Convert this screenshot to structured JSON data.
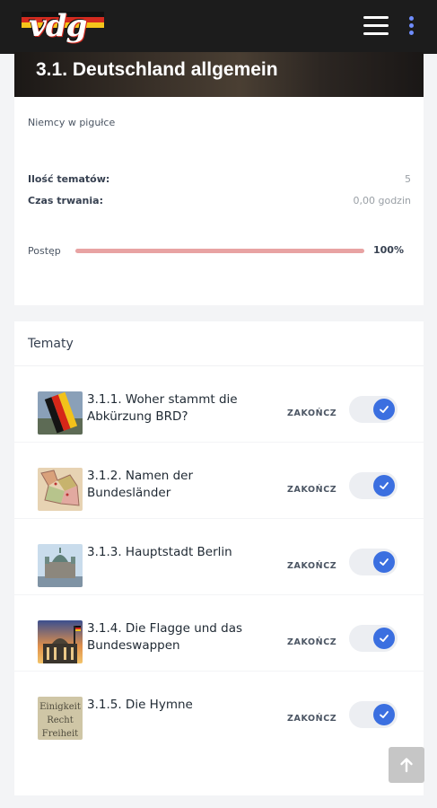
{
  "header": {
    "logo_text": "vdg",
    "logo_colors": [
      "#111111",
      "#d42a1f",
      "#f5c41b"
    ],
    "menu_icon": "hamburger-icon",
    "more_icon": "kebab-menu-icon",
    "accent": "#6f8dff"
  },
  "course": {
    "title": "3.1. Deutschland allgemein",
    "description": "Niemcy w pigułce",
    "meta": [
      {
        "label": "Ilość tematów:",
        "value": "5"
      },
      {
        "label": "Czas trwania:",
        "value": "0,00 godzin"
      }
    ],
    "progress": {
      "label": "Postęp",
      "percent": 100,
      "percent_text": "100%",
      "color": "#e8a3a3"
    }
  },
  "topics": {
    "title": "Tematy",
    "items": [
      {
        "title": "3.1.1. Woher stammt die Abkürzung BRD?",
        "action": "ZAKOŃCZ",
        "completed": true,
        "thumbnail": "flag-image"
      },
      {
        "title": "3.1.2. Namen der Bundesländer",
        "action": "ZAKOŃCZ",
        "completed": true,
        "thumbnail": "map-image"
      },
      {
        "title": "3.1.3. Hauptstadt Berlin",
        "action": "ZAKOŃCZ",
        "completed": true,
        "thumbnail": "berlin-cathedral-image"
      },
      {
        "title": "3.1.4. Die Flagge und das Bundeswappen",
        "action": "ZAKOŃCZ",
        "completed": true,
        "thumbnail": "reichstag-image"
      },
      {
        "title": "3.1.5. Die Hymne",
        "action": "ZAKOŃCZ",
        "completed": true,
        "thumbnail": "hymn-text-image",
        "thumbnail_text": [
          "Einigkeit",
          "Recht",
          "Freiheit"
        ]
      }
    ],
    "toggle_color": "#3b6fe0"
  },
  "back_to_top_icon": "arrow-up-icon"
}
